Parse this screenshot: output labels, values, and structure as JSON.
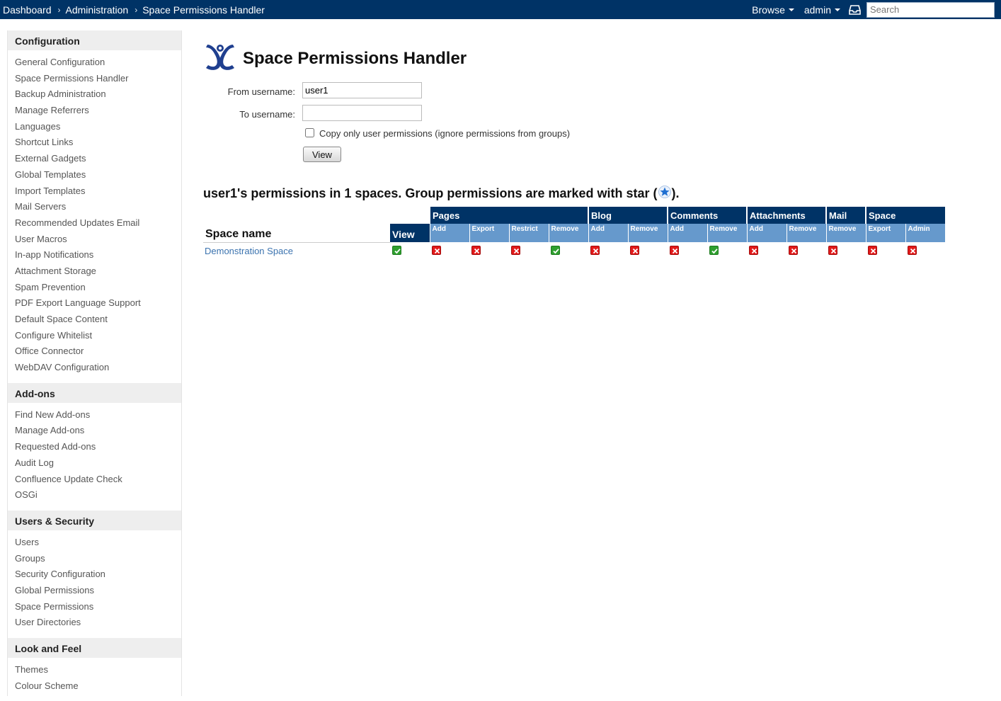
{
  "header": {
    "breadcrumbs": [
      "Dashboard",
      "Administration",
      "Space Permissions Handler"
    ],
    "browse_label": "Browse",
    "user_label": "admin",
    "search_placeholder": "Search",
    "colors": {
      "bar": "#003366"
    }
  },
  "sidebar": {
    "sections": [
      {
        "title": "Configuration",
        "items": [
          "General Configuration",
          "Space Permissions Handler",
          "Backup Administration",
          "Manage Referrers",
          "Languages",
          "Shortcut Links",
          "External Gadgets",
          "Global Templates",
          "Import Templates",
          "Mail Servers",
          "Recommended Updates Email",
          "User Macros",
          "In-app Notifications",
          "Attachment Storage",
          "Spam Prevention",
          "PDF Export Language Support",
          "Default Space Content",
          "Configure Whitelist",
          "Office Connector",
          "WebDAV Configuration"
        ]
      },
      {
        "title": "Add-ons",
        "items": [
          "Find New Add-ons",
          "Manage Add-ons",
          "Requested Add-ons",
          "Audit Log",
          "Confluence Update Check",
          "OSGi"
        ]
      },
      {
        "title": "Users & Security",
        "items": [
          "Users",
          "Groups",
          "Security Configuration",
          "Global Permissions",
          "Space Permissions",
          "User Directories"
        ]
      },
      {
        "title": "Look and Feel",
        "items": [
          "Themes",
          "Colour Scheme"
        ]
      }
    ]
  },
  "main": {
    "title": "Space Permissions Handler",
    "from_label": "From username:",
    "from_value": "user1",
    "to_label": "To username:",
    "to_value": "",
    "copy_only_label": "Copy only user permissions (ignore permissions from groups)",
    "copy_only_checked": false,
    "view_button": "View",
    "results_heading_before": "user1's permissions in 1 spaces. Group permissions are marked with star (",
    "results_heading_after": ")."
  },
  "table": {
    "space_name_header": "Space name",
    "view_header": "View",
    "groups": [
      {
        "name": "Pages",
        "subs": [
          "Add",
          "Export",
          "Restrict",
          "Remove"
        ]
      },
      {
        "name": "Blog",
        "subs": [
          "Add",
          "Remove"
        ]
      },
      {
        "name": "Comments",
        "subs": [
          "Add",
          "Remove"
        ]
      },
      {
        "name": "Attachments",
        "subs": [
          "Add",
          "Remove"
        ]
      },
      {
        "name": "Mail",
        "subs": [
          "Remove"
        ]
      },
      {
        "name": "Space",
        "subs": [
          "Export",
          "Admin"
        ]
      }
    ],
    "rows": [
      {
        "space": "Demonstration Space",
        "view": true,
        "perms": [
          false,
          false,
          false,
          true,
          false,
          false,
          false,
          true,
          false,
          false,
          false,
          false,
          false
        ]
      }
    ],
    "colors": {
      "granted": "#2f9f2f",
      "denied": "#e21a1a",
      "group_header": "#003366",
      "sub_header": "#6699cc"
    }
  }
}
